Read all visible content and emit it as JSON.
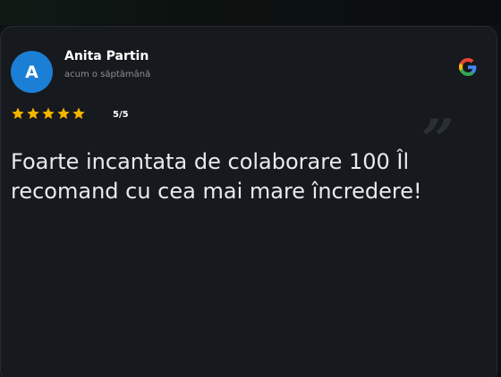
{
  "reviewer": {
    "initial": "A",
    "name": "Anita Partin",
    "time": "acum o săptămână"
  },
  "rating": {
    "stars": 5,
    "max": 5,
    "label": "5/5"
  },
  "review": {
    "text": "Foarte incantata de colaborare 100 Îl recomand cu cea mai mare încredere!"
  },
  "source_icon": "google-icon",
  "colors": {
    "avatar": "#1c7fd6",
    "star": "#f4b400",
    "card_bg": "#16191d",
    "page_bg": "#0e1114"
  }
}
